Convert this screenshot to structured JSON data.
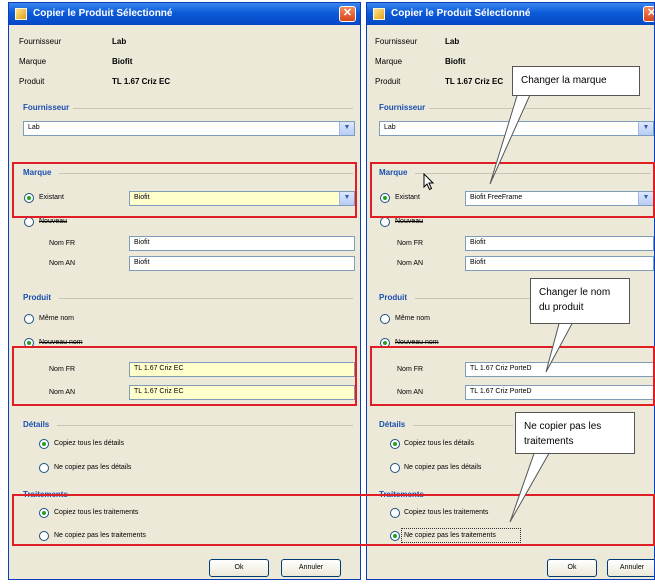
{
  "title": "Copier le Produit Sélectionné",
  "info": {
    "fournisseur_label": "Fournisseur",
    "fournisseur_value": "Lab",
    "marque_label": "Marque",
    "marque_value": "Biofit",
    "produit_label": "Produit",
    "produit_value": "TL 1.67 Criz EC"
  },
  "sections": {
    "fournisseur": "Fournisseur",
    "marque": "Marque",
    "produit": "Produit",
    "details": "Détails",
    "traitements": "Traitements"
  },
  "fournisseur_combo": "Lab",
  "marque": {
    "existant_label": "Existant",
    "nouveau_label": "Nouveau",
    "nom_fr_label": "Nom FR",
    "nom_an_label": "Nom AN",
    "left": {
      "existant_value": "Biofit",
      "nom_fr": "Biofit",
      "nom_an": "Biofit"
    },
    "right": {
      "existant_value": "Biofit FreeFrame",
      "nom_fr": "Biofit",
      "nom_an": "Biofit"
    }
  },
  "produit": {
    "meme_nom_label": "Même nom",
    "nouveau_nom_label": "Nouveau nom",
    "nom_fr_label": "Nom FR",
    "nom_an_label": "Nom AN",
    "left": {
      "nom_fr": "TL 1.67 Criz EC",
      "nom_an": "TL 1.67 Criz EC"
    },
    "right": {
      "nom_fr": "TL 1.67 Criz PorteD",
      "nom_an": "TL 1.67 Criz PorteD"
    }
  },
  "details": {
    "copy_all": "Copiez tous les détails",
    "no_copy": "Ne copiez pas les détails"
  },
  "traitements": {
    "copy_all": "Copiez tous les traitements",
    "no_copy": "Ne copiez pas les traitements"
  },
  "buttons": {
    "ok": "Ok",
    "cancel": "Annuler"
  },
  "callouts": {
    "marque": "Changer la marque",
    "nom": "Changer le nom du produit",
    "traitements": "Ne copier pas les traitements"
  },
  "colors": {
    "title_bar": "#0b5ad8",
    "highlight": "#e01e25",
    "section_heading": "#1a4fb0",
    "field_highlight": "#ffffcc"
  }
}
